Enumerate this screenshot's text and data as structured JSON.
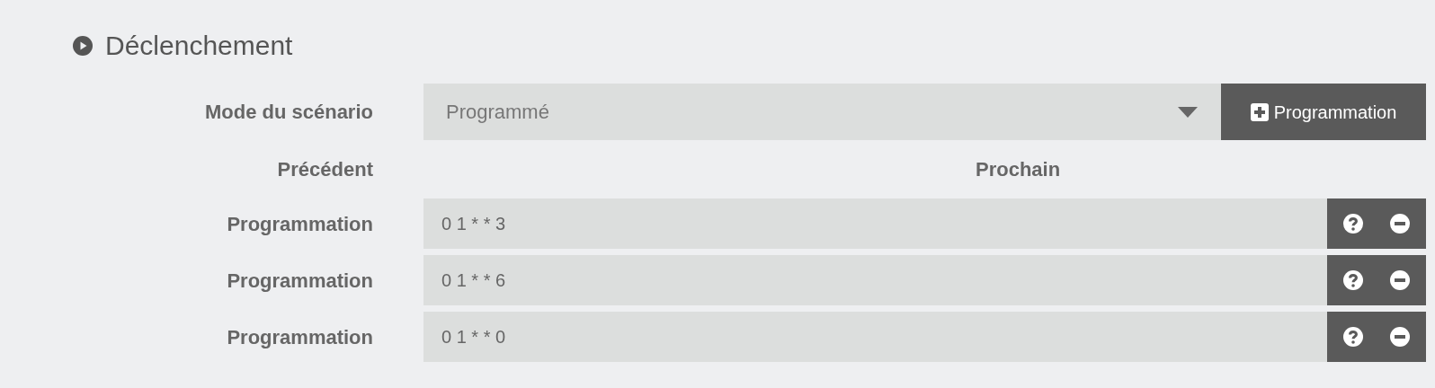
{
  "section": {
    "title": "Déclenchement"
  },
  "mode": {
    "label": "Mode du scénario",
    "value": "Programmé",
    "add_button": "Programmation"
  },
  "previous": {
    "label": "Précédent"
  },
  "next": {
    "label": "Prochain"
  },
  "schedules": [
    {
      "label": "Programmation",
      "value": "0 1 * * 3"
    },
    {
      "label": "Programmation",
      "value": "0 1 * * 6"
    },
    {
      "label": "Programmation",
      "value": "0 1 * * 0"
    }
  ]
}
